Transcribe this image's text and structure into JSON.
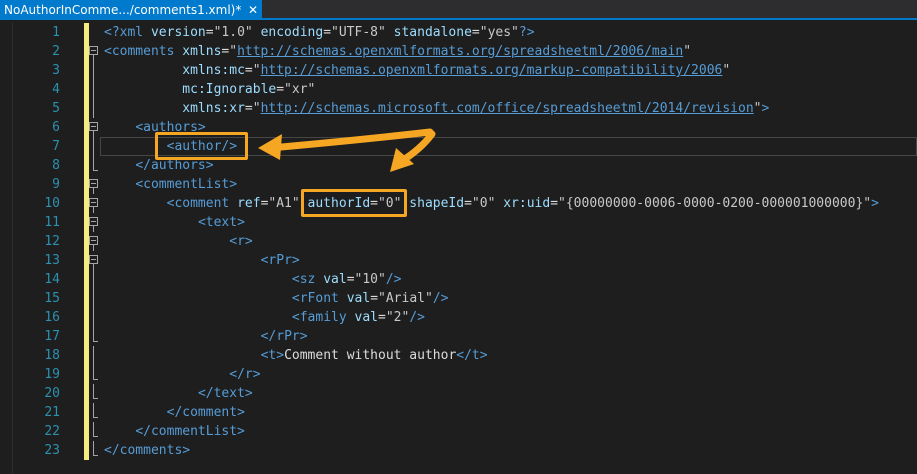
{
  "tab": {
    "title": "NoAuthorInComme.../comments1.xml)*",
    "close_glyph": "✕"
  },
  "lines": [
    {
      "n": "1",
      "indent": 0,
      "fold": "none",
      "tokens": [
        [
          "tag",
          "<?xml "
        ],
        [
          "attr",
          "version"
        ],
        [
          "txt",
          "="
        ],
        [
          "val",
          "\"1.0\" "
        ],
        [
          "attr",
          "encoding"
        ],
        [
          "txt",
          "="
        ],
        [
          "val",
          "\"UTF-8\" "
        ],
        [
          "attr",
          "standalone"
        ],
        [
          "txt",
          "="
        ],
        [
          "val",
          "\"yes\""
        ],
        [
          "tag",
          "?>"
        ]
      ]
    },
    {
      "n": "2",
      "indent": 0,
      "fold": "open",
      "tokens": [
        [
          "tag",
          "<comments "
        ],
        [
          "attr",
          "xmlns"
        ],
        [
          "txt",
          "="
        ],
        [
          "val",
          "\""
        ],
        [
          "link",
          "http://schemas.openxmlformats.org/spreadsheetml/2006/main"
        ],
        [
          "val",
          "\""
        ]
      ]
    },
    {
      "n": "3",
      "indent": 10,
      "fold": "line",
      "tokens": [
        [
          "attr",
          "xmlns:mc"
        ],
        [
          "txt",
          "="
        ],
        [
          "val",
          "\""
        ],
        [
          "link",
          "http://schemas.openxmlformats.org/markup-compatibility/2006"
        ],
        [
          "val",
          "\""
        ]
      ]
    },
    {
      "n": "4",
      "indent": 10,
      "fold": "line",
      "tokens": [
        [
          "attr",
          "mc:Ignorable"
        ],
        [
          "txt",
          "="
        ],
        [
          "val",
          "\"xr\""
        ]
      ]
    },
    {
      "n": "5",
      "indent": 10,
      "fold": "line",
      "tokens": [
        [
          "attr",
          "xmlns:xr"
        ],
        [
          "txt",
          "="
        ],
        [
          "val",
          "\""
        ],
        [
          "link",
          "http://schemas.microsoft.com/office/spreadsheetml/2014/revision"
        ],
        [
          "val",
          "\""
        ],
        [
          "tag",
          ">"
        ]
      ]
    },
    {
      "n": "6",
      "indent": 4,
      "fold": "open",
      "tokens": [
        [
          "tag",
          "<authors>"
        ]
      ]
    },
    {
      "n": "7",
      "indent": 8,
      "fold": "line",
      "tokens": [
        [
          "tag",
          "<author/>"
        ]
      ]
    },
    {
      "n": "8",
      "indent": 4,
      "fold": "end",
      "tokens": [
        [
          "tag",
          "</authors>"
        ]
      ]
    },
    {
      "n": "9",
      "indent": 4,
      "fold": "open",
      "tokens": [
        [
          "tag",
          "<commentList>"
        ]
      ]
    },
    {
      "n": "10",
      "indent": 8,
      "fold": "open",
      "tokens": [
        [
          "tag",
          "<comment "
        ],
        [
          "attr",
          "ref"
        ],
        [
          "txt",
          "="
        ],
        [
          "val",
          "\"A1\" "
        ],
        [
          "attr",
          "authorId"
        ],
        [
          "txt",
          "="
        ],
        [
          "val",
          "\"0\" "
        ],
        [
          "attr",
          "shapeId"
        ],
        [
          "txt",
          "="
        ],
        [
          "val",
          "\"0\" "
        ],
        [
          "attr",
          "xr:uid"
        ],
        [
          "txt",
          "="
        ],
        [
          "val",
          "\"{00000000-0006-0000-0200-000001000000}\""
        ],
        [
          "tag",
          ">"
        ]
      ]
    },
    {
      "n": "11",
      "indent": 12,
      "fold": "open",
      "tokens": [
        [
          "tag",
          "<text>"
        ]
      ]
    },
    {
      "n": "12",
      "indent": 16,
      "fold": "open",
      "tokens": [
        [
          "tag",
          "<r>"
        ]
      ]
    },
    {
      "n": "13",
      "indent": 20,
      "fold": "open",
      "tokens": [
        [
          "tag",
          "<rPr>"
        ]
      ]
    },
    {
      "n": "14",
      "indent": 24,
      "fold": "line",
      "tokens": [
        [
          "tag",
          "<sz "
        ],
        [
          "attr",
          "val"
        ],
        [
          "txt",
          "="
        ],
        [
          "val",
          "\"10\""
        ],
        [
          "tag",
          "/>"
        ]
      ]
    },
    {
      "n": "15",
      "indent": 24,
      "fold": "line",
      "tokens": [
        [
          "tag",
          "<rFont "
        ],
        [
          "attr",
          "val"
        ],
        [
          "txt",
          "="
        ],
        [
          "val",
          "\"Arial\""
        ],
        [
          "tag",
          "/>"
        ]
      ]
    },
    {
      "n": "16",
      "indent": 24,
      "fold": "line",
      "tokens": [
        [
          "tag",
          "<family "
        ],
        [
          "attr",
          "val"
        ],
        [
          "txt",
          "="
        ],
        [
          "val",
          "\"2\""
        ],
        [
          "tag",
          "/>"
        ]
      ]
    },
    {
      "n": "17",
      "indent": 20,
      "fold": "end",
      "tokens": [
        [
          "tag",
          "</rPr>"
        ]
      ]
    },
    {
      "n": "18",
      "indent": 20,
      "fold": "line",
      "tokens": [
        [
          "tag",
          "<t>"
        ],
        [
          "txt",
          "Comment without author"
        ],
        [
          "tag",
          "</t>"
        ]
      ]
    },
    {
      "n": "19",
      "indent": 16,
      "fold": "end",
      "tokens": [
        [
          "tag",
          "</r>"
        ]
      ]
    },
    {
      "n": "20",
      "indent": 12,
      "fold": "end",
      "tokens": [
        [
          "tag",
          "</text>"
        ]
      ]
    },
    {
      "n": "21",
      "indent": 8,
      "fold": "end",
      "tokens": [
        [
          "tag",
          "</comment>"
        ]
      ]
    },
    {
      "n": "22",
      "indent": 4,
      "fold": "end",
      "tokens": [
        [
          "tag",
          "</commentList>"
        ]
      ]
    },
    {
      "n": "23",
      "indent": 0,
      "fold": "end",
      "tokens": [
        [
          "tag",
          "</comments>"
        ]
      ]
    }
  ],
  "colors": {
    "accent": "#007acc",
    "highlight": "#f5a623",
    "change_bar": "#f4ec7c"
  }
}
